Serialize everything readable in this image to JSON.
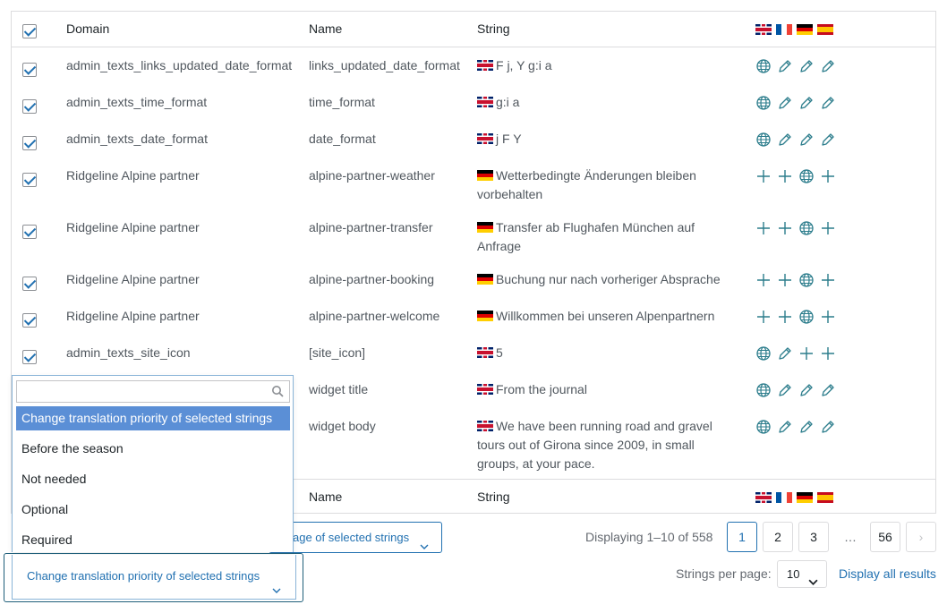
{
  "header": {
    "domain_label": "Domain",
    "name_label": "Name",
    "string_label": "String",
    "languages": [
      "flag-uk",
      "flag-fr",
      "flag-de",
      "flag-es"
    ]
  },
  "rows": [
    {
      "domain": "admin_texts_links_updated_date_format",
      "name": "links_updated_date_format",
      "flag": "uk",
      "string": "F j, Y g:i a",
      "actions": [
        "globe",
        "pencil",
        "pencil",
        "pencil"
      ]
    },
    {
      "domain": "admin_texts_time_format",
      "name": "time_format",
      "flag": "uk",
      "string": "g:i a",
      "actions": [
        "globe",
        "pencil",
        "pencil",
        "pencil"
      ]
    },
    {
      "domain": "admin_texts_date_format",
      "name": "date_format",
      "flag": "uk",
      "string": "j F Y",
      "actions": [
        "globe",
        "pencil",
        "pencil",
        "pencil"
      ]
    },
    {
      "domain": "Ridgeline Alpine partner",
      "name": "alpine-partner-weather",
      "flag": "de",
      "string": "Wetterbedingte Änderungen bleiben vorbehalten",
      "actions": [
        "plus",
        "plus",
        "globe",
        "plus"
      ]
    },
    {
      "domain": "Ridgeline Alpine partner",
      "name": "alpine-partner-transfer",
      "flag": "de",
      "string": "Transfer ab Flughafen München auf Anfrage",
      "actions": [
        "plus",
        "plus",
        "globe",
        "plus"
      ]
    },
    {
      "domain": "Ridgeline Alpine partner",
      "name": "alpine-partner-booking",
      "flag": "de",
      "string": "Buchung nur nach vorheriger Absprache",
      "actions": [
        "plus",
        "plus",
        "globe",
        "plus"
      ]
    },
    {
      "domain": "Ridgeline Alpine partner",
      "name": "alpine-partner-welcome",
      "flag": "de",
      "string": "Willkommen bei unseren Alpenpartnern",
      "actions": [
        "plus",
        "plus",
        "globe",
        "plus"
      ]
    },
    {
      "domain": "admin_texts_site_icon",
      "name": "[site_icon]",
      "flag": "uk",
      "string": "5",
      "actions": [
        "globe",
        "pencil",
        "plus",
        "plus"
      ]
    },
    {
      "domain": "",
      "name": "widget title",
      "flag": "uk",
      "string": "From the journal",
      "actions": [
        "globe",
        "pencil",
        "pencil",
        "pencil"
      ]
    },
    {
      "domain": "",
      "name": "widget body",
      "flag": "uk",
      "string": "We have been running road and gravel tours out of Girona since 2009, in small groups, at your pace.",
      "actions": [
        "globe",
        "pencil",
        "pencil",
        "pencil"
      ]
    }
  ],
  "footer": {
    "name_label": "Name",
    "string_label": "String"
  },
  "dropdown": {
    "search_value": "",
    "options": [
      "Change translation priority of selected strings",
      "Before the season",
      "Not needed",
      "Optional",
      "Required"
    ],
    "selected": "Change translation priority of selected strings"
  },
  "bulk": {
    "priority_combo_label": "Change translation priority of selected strings",
    "second_button_label": "age of selected strings"
  },
  "pagination": {
    "info": "Displaying 1–10 of 558",
    "pages": [
      "1",
      "2",
      "3",
      "56"
    ],
    "current": "1",
    "ellipsis": "…",
    "next": "›"
  },
  "per_page": {
    "label": "Strings per page:",
    "value": "10",
    "display_all": "Display all results"
  },
  "colors": {
    "accent": "#2271b1",
    "icon": "#2c7d8c",
    "selected_option": "#5b8fd6"
  }
}
